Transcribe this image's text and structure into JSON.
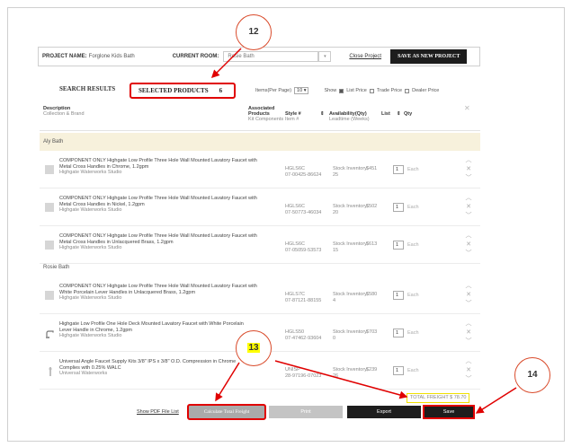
{
  "project": {
    "name_label": "PROJECT NAME:",
    "name_value": "Forglone Kids Bath",
    "room_label": "CURRENT ROOM:",
    "room_value": "Rosie Bath",
    "close_label": "Close Project",
    "save_new_label": "SAVE AS NEW PROJECT"
  },
  "tabs": {
    "search_results": "SEARCH RESULTS",
    "selected_products": "SELECTED PRODUCTS",
    "selected_count": "6"
  },
  "options": {
    "items_label": "Items(Per Page)",
    "items_value": "10",
    "show_label": "Show",
    "list_price": "List Price",
    "trade_price": "Trade Price",
    "dealer_price": "Dealer Price"
  },
  "columns": {
    "description": "Description",
    "description_sub": "Collection & Brand",
    "associated": "Associated Products",
    "associated_sub": "Kit Components",
    "style": "Style #",
    "style_sub": "Item #",
    "availability": "Availability(Qty)",
    "availability_sub": "Leadtime (Weeks)",
    "list": "List",
    "qty": "Qty"
  },
  "groups": [
    {
      "name": "Aly Bath",
      "rows": [
        {
          "desc": "COMPONENT ONLY Highgate Low Profile Three Hole Wall Mounted Lavatory Faucet with Metal Cross Handles in Chrome, 1.2gpm",
          "brand": "Highgate  Waterworks Studio",
          "style": "HGLS6C",
          "item": "07-00425-86624",
          "avail": "Stock Inventory",
          "lead": "25",
          "price": "$451",
          "qty": "1",
          "unit": "Each"
        },
        {
          "desc": "COMPONENT ONLY Highgate Low Profile Three Hole Wall Mounted Lavatory Faucet with Metal Cross Handles in Nickel, 1.2gpm",
          "brand": "Highgate  Waterworks Studio",
          "style": "HGLS6C",
          "item": "07-50773-46034",
          "avail": "Stock Inventory",
          "lead": "20",
          "price": "$502",
          "qty": "1",
          "unit": "Each"
        },
        {
          "desc": "COMPONENT ONLY Highgate Low Profile Three Hole Wall Mounted Lavatory Faucet with Metal Cross Handles in Unlacquered Brass, 1.2gpm",
          "brand": "Highgate  Waterworks Studio",
          "style": "HGLS6C",
          "item": "07-05059-53573",
          "avail": "Stock Inventory",
          "lead": "15",
          "price": "$613",
          "qty": "1",
          "unit": "Each"
        }
      ]
    },
    {
      "name": "Rosie Bath",
      "rows": [
        {
          "desc": "COMPONENT ONLY Highgate Low Profile Three Hole Wall Mounted Lavatory Faucet with White Porcelain Lever Handles in Unlacquered Brass, 1.2gpm",
          "brand": "Highgate  Waterworks Studio",
          "style": "HGLS7C",
          "item": "07-87121-88155",
          "avail": "Stock Inventory",
          "lead": "4",
          "price": "$580",
          "qty": "1",
          "unit": "Each"
        },
        {
          "desc": "Highgate Low Profile One Hole Deck Mounted Lavatory Faucet with White Porcelain Lever Handle in Chrome, 1.2gpm",
          "brand": "Highgate  Waterworks Studio",
          "style": "HGLS50",
          "item": "07-47462-93604",
          "avail": "Stock Inventory",
          "lead": "0",
          "price": "$703",
          "qty": "1",
          "unit": "Each"
        },
        {
          "desc": "Universal Angle Faucet Supply Kits 3/8\" IPS x 3/8\" O.D. Compression in Chrome Complies with 0.25% WALC",
          "brand": "Universal  Waterworks",
          "style": "UNISP",
          "item": "28-97196-07023",
          "avail": "Stock Inventory",
          "lead": "26",
          "price": "$239",
          "qty": "1",
          "unit": "Each"
        }
      ]
    }
  ],
  "footer": {
    "total_freight": "TOTAL FREIGHT $ 78.70",
    "pdf_link": "Show PDF File List",
    "calc": "Calculate Total Freight",
    "print": "Print",
    "export": "Export",
    "save": "Save"
  },
  "callouts": {
    "c12": "12",
    "c13": "13",
    "c14": "14"
  },
  "colors": {
    "highlight_red": "#e00000",
    "callout_border": "#d94a2a",
    "freight_box": "#f0e000",
    "group_bg": "#f7f1dc",
    "dark_button": "#1d1d1d"
  }
}
